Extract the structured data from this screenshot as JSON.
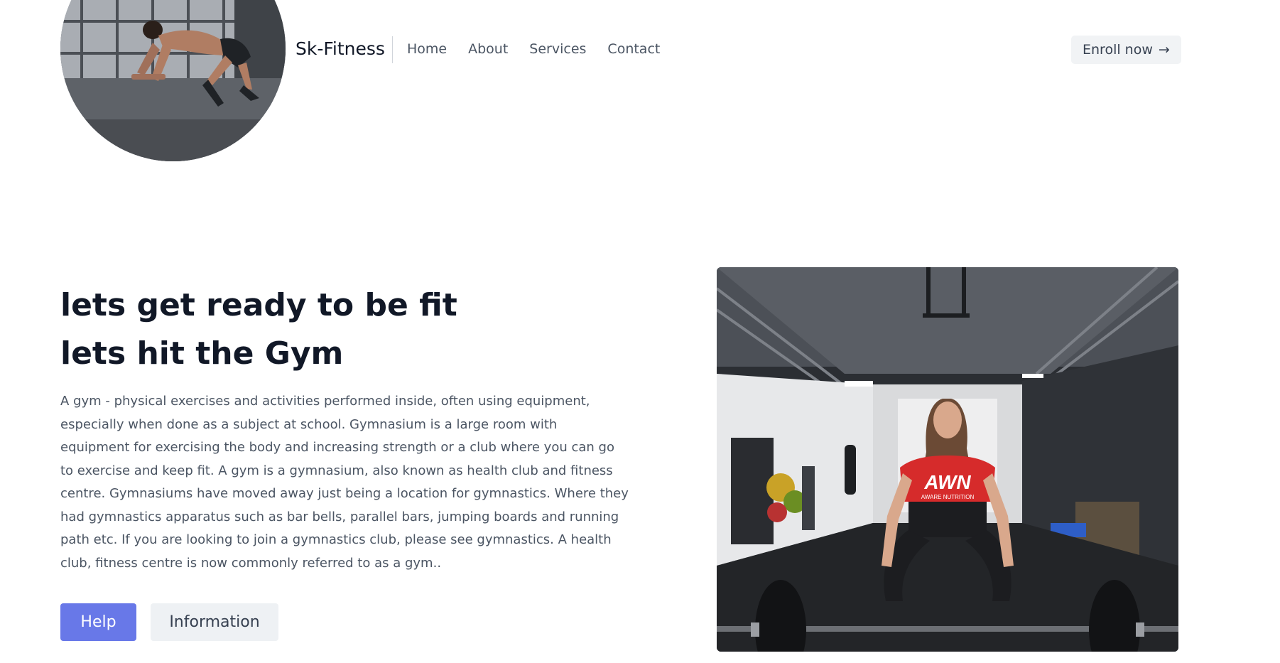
{
  "header": {
    "brand": "Sk-Fitness",
    "nav": [
      {
        "label": "Home"
      },
      {
        "label": "About"
      },
      {
        "label": "Services"
      },
      {
        "label": "Contact"
      }
    ],
    "enroll_label": "Enroll now",
    "enroll_icon": "arrow-right-icon"
  },
  "hero": {
    "title_line1": "lets get ready to be fit",
    "title_line2": "lets hit the Gym",
    "description": "A gym - physical exercises and activities performed inside, often using equipment, especially when done as a subject at school. Gymnasium is a large room with equipment for exercising the body and increasing strength or a club where you can go to exercise and keep fit. A gym is a gymnasium, also known as health club and fitness centre. Gymnasiums have moved away just being a location for gymnastics. Where they had gymnastics apparatus such as bar bells, parallel bars, jumping boards and running path etc. If you are looking to join a gymnastics club, please see gymnastics. A health club, fitness centre is now commonly referred to as a gym..",
    "help_label": "Help",
    "info_label": "Information",
    "photo_shirt_text": "AWN",
    "photo_shirt_subtext": "AWARE NUTRITION"
  },
  "colors": {
    "primary_button": "#6878e8",
    "secondary_button": "#eef1f4",
    "heading": "#111827",
    "body_text": "#4b5563"
  }
}
